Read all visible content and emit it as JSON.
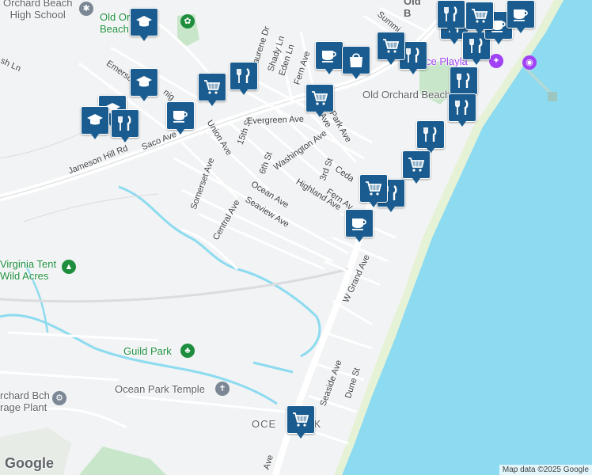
{
  "map": {
    "streets": [
      {
        "id": "saco-ave",
        "label": "Saco Ave"
      },
      {
        "id": "union-ave",
        "label": "Union Ave"
      },
      {
        "id": "15th-st",
        "label": "15th St"
      },
      {
        "id": "evergreen-ave",
        "label": "Evergreen Ave"
      },
      {
        "id": "washington-ave",
        "label": "Washington Ave"
      },
      {
        "id": "6th-st",
        "label": "6th St"
      },
      {
        "id": "somerset-ave",
        "label": "Somerset Ave"
      },
      {
        "id": "ocean-ave",
        "label": "Ocean Ave"
      },
      {
        "id": "seaview-ave",
        "label": "Seaview Ave"
      },
      {
        "id": "central-ave",
        "label": "Central Ave"
      },
      {
        "id": "highland-ave",
        "label": "Highland Ave"
      },
      {
        "id": "3rd-st",
        "label": "3rd St"
      },
      {
        "id": "cedar",
        "label": "Ceda"
      },
      {
        "id": "fern-av",
        "label": "Fern Av"
      },
      {
        "id": "w-grand-ave",
        "label": "W Grand Ave"
      },
      {
        "id": "seaside-ave",
        "label": "Seaside Ave"
      },
      {
        "id": "dune-st",
        "label": "Dune St"
      },
      {
        "id": "jameson-hill-rd",
        "label": "Jameson Hill Rd"
      },
      {
        "id": "emerson",
        "label": "Emerso"
      },
      {
        "id": "laurene-dr",
        "label": "Laurene Dr"
      },
      {
        "id": "shady-ln",
        "label": "Shady Ln"
      },
      {
        "id": "eden-ln",
        "label": "Eden Ln"
      },
      {
        "id": "fern-ave-n",
        "label": "Fern Ave"
      },
      {
        "id": "park-ave",
        "label": "Park Ave"
      },
      {
        "id": "ames-ave",
        "label": "mes Ave"
      },
      {
        "id": "sh-ln",
        "label": "sh Ln"
      },
      {
        "id": "summit",
        "label": "Summi"
      },
      {
        "id": "ave-bottom",
        "label": "Ave"
      },
      {
        "id": "nig",
        "label": "nig"
      }
    ],
    "places": [
      {
        "id": "orchard-beach-high-school",
        "label": "Orchard Beach\nHigh School"
      },
      {
        "id": "old-orchard-beach-park",
        "label": "Old Orchard\nBeach Park"
      },
      {
        "id": "old-orchard-beach-town",
        "label": "Old Orchard Beach"
      },
      {
        "id": "virginia-tent",
        "label": "Virginia Tent\nWild Acres"
      },
      {
        "id": "guild-park",
        "label": "Guild Park"
      },
      {
        "id": "ocean-park-temple",
        "label": "Ocean Park Temple"
      },
      {
        "id": "orchard-bch-storage",
        "label": "rchard Bch\nrage Plant"
      },
      {
        "id": "palace-playland",
        "label": "ce Playla"
      },
      {
        "id": "ocean-park",
        "label": "OCE        RK"
      },
      {
        "id": "old-b-top",
        "label": "Old\nB"
      }
    ],
    "pins": [
      {
        "type": "school"
      },
      {
        "type": "school"
      },
      {
        "type": "school"
      },
      {
        "type": "school"
      },
      {
        "type": "restaurant"
      },
      {
        "type": "restaurant"
      },
      {
        "type": "restaurant"
      },
      {
        "type": "restaurant"
      },
      {
        "type": "restaurant"
      },
      {
        "type": "restaurant"
      },
      {
        "type": "restaurant"
      },
      {
        "type": "restaurant"
      },
      {
        "type": "restaurant"
      },
      {
        "type": "restaurant"
      },
      {
        "type": "cafe"
      },
      {
        "type": "cafe"
      },
      {
        "type": "cafe"
      },
      {
        "type": "cafe"
      },
      {
        "type": "cafe"
      },
      {
        "type": "grocery"
      },
      {
        "type": "grocery"
      },
      {
        "type": "grocery"
      },
      {
        "type": "grocery"
      },
      {
        "type": "grocery"
      },
      {
        "type": "grocery"
      },
      {
        "type": "grocery"
      },
      {
        "type": "shopping"
      }
    ],
    "attribution": "Map data ©2025 Google",
    "logo": "Google",
    "colors": {
      "water": "#8ddbf0",
      "land": "#f1f3f4",
      "park": "#c8e6c9",
      "road": "#ffffff",
      "pin": "#1a5c8f",
      "beach": "#e8f0d8"
    }
  }
}
